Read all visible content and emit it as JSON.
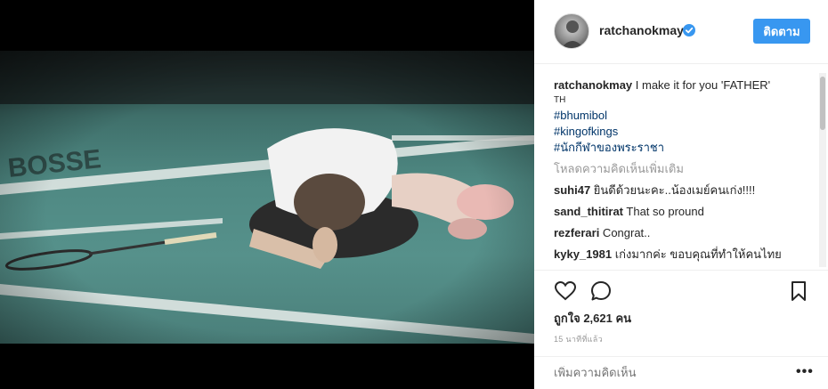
{
  "post": {
    "username": "ratchanokmay",
    "follow_label": "ติดตาม",
    "caption_text": " I make it for you 'FATHER'",
    "caption_line2": "TH",
    "hashtags": [
      "#bhumibol",
      "#kingofkings",
      "#นักกีฬาของพระราชา"
    ],
    "load_more_label": "โหลดความคิดเห็นเพิ่มเติม",
    "comments": [
      {
        "user": "suhi47",
        "text": " ยินดีด้วยนะคะ..น้องเมย์คนเก่ง!!!!"
      },
      {
        "user": "sand_thitirat",
        "text": " That so pround"
      },
      {
        "user": "rezferari",
        "text": " Congrat.."
      },
      {
        "user": "kyky_1981",
        "text": " เก่งมากค่ะ ขอบคุณที่ทำให้คนไทย"
      }
    ],
    "likes_text": "ถูกใจ 2,621 คน",
    "time_text": "15 นาทีที่แล้ว",
    "add_comment_placeholder": "เพิ่มความคิดเห็น",
    "more_options_label": "•••"
  },
  "icons": {
    "verified": "verified-badge-icon",
    "like": "heart-icon",
    "comment": "comment-bubble-icon",
    "save": "bookmark-icon"
  },
  "colors": {
    "accent": "#3897f0",
    "hashtag": "#003569",
    "muted": "#999999",
    "text": "#262626"
  }
}
